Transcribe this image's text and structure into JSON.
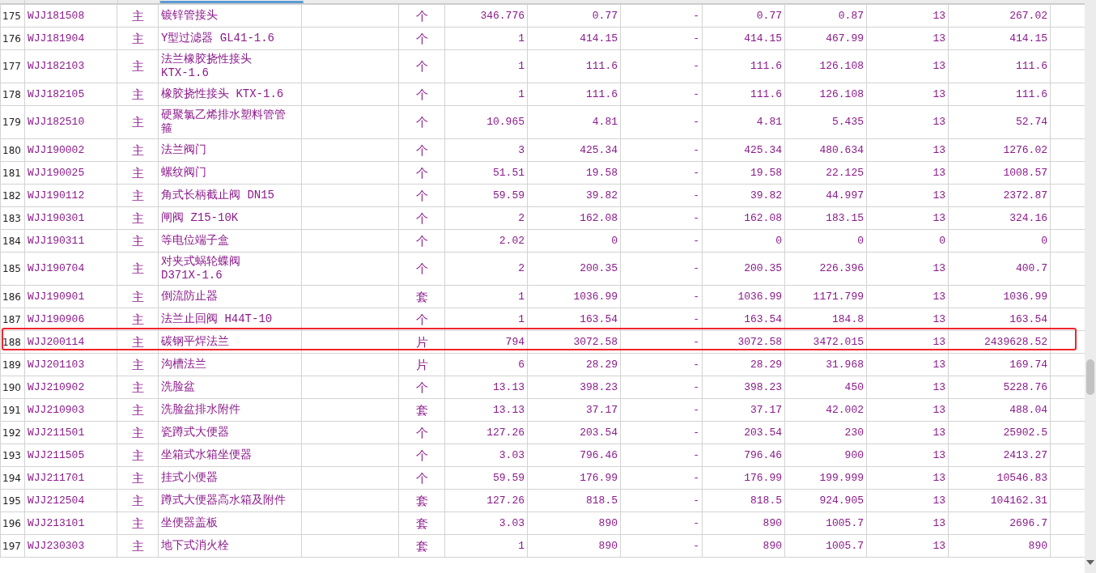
{
  "rows": [
    {
      "cells": [
        "175",
        "WJJ181508",
        "主",
        "镀锌管接头",
        "个",
        "346.776",
        "0.77",
        "-",
        "0.77",
        "0.87",
        "13",
        "267.02"
      ],
      "highlighted": false
    },
    {
      "cells": [
        "176",
        "WJJ181904",
        "主",
        "Y型过滤器 GL41-1.6",
        "个",
        "1",
        "414.15",
        "-",
        "414.15",
        "467.99",
        "13",
        "414.15"
      ],
      "highlighted": false
    },
    {
      "cells": [
        "177",
        "WJJ182103",
        "主",
        "法兰橡胶挠性接头 KTX-1.6",
        "个",
        "1",
        "111.6",
        "-",
        "111.6",
        "126.108",
        "13",
        "111.6"
      ],
      "highlighted": false
    },
    {
      "cells": [
        "178",
        "WJJ182105",
        "主",
        "橡胶挠性接头 KTX-1.6",
        "个",
        "1",
        "111.6",
        "-",
        "111.6",
        "126.108",
        "13",
        "111.6"
      ],
      "highlighted": false
    },
    {
      "cells": [
        "179",
        "WJJ182510",
        "主",
        "硬聚氯乙烯排水塑料管管箍",
        "个",
        "10.965",
        "4.81",
        "-",
        "4.81",
        "5.435",
        "13",
        "52.74"
      ],
      "highlighted": false
    },
    {
      "cells": [
        "180",
        "WJJ190002",
        "主",
        "法兰阀门",
        "个",
        "3",
        "425.34",
        "-",
        "425.34",
        "480.634",
        "13",
        "1276.02"
      ],
      "highlighted": false
    },
    {
      "cells": [
        "181",
        "WJJ190025",
        "主",
        "螺纹阀门",
        "个",
        "51.51",
        "19.58",
        "-",
        "19.58",
        "22.125",
        "13",
        "1008.57"
      ],
      "highlighted": false
    },
    {
      "cells": [
        "182",
        "WJJ190112",
        "主",
        "角式长柄截止阀 DN15",
        "个",
        "59.59",
        "39.82",
        "-",
        "39.82",
        "44.997",
        "13",
        "2372.87"
      ],
      "highlighted": false
    },
    {
      "cells": [
        "183",
        "WJJ190301",
        "主",
        "闸阀 Z15-10K",
        "个",
        "2",
        "162.08",
        "-",
        "162.08",
        "183.15",
        "13",
        "324.16"
      ],
      "highlighted": false
    },
    {
      "cells": [
        "184",
        "WJJ190311",
        "主",
        "等电位端子盒",
        "个",
        "2.02",
        "0",
        "-",
        "0",
        "0",
        "0",
        "0"
      ],
      "highlighted": false
    },
    {
      "cells": [
        "185",
        "WJJ190704",
        "主",
        "对夹式蜗轮蝶阀 D371X-1.6",
        "个",
        "2",
        "200.35",
        "-",
        "200.35",
        "226.396",
        "13",
        "400.7"
      ],
      "highlighted": false
    },
    {
      "cells": [
        "186",
        "WJJ190901",
        "主",
        "倒流防止器",
        "套",
        "1",
        "1036.99",
        "-",
        "1036.99",
        "1171.799",
        "13",
        "1036.99"
      ],
      "highlighted": false
    },
    {
      "cells": [
        "187",
        "WJJ190906",
        "主",
        "法兰止回阀 H44T-10",
        "个",
        "1",
        "163.54",
        "-",
        "163.54",
        "184.8",
        "13",
        "163.54"
      ],
      "highlighted": false
    },
    {
      "cells": [
        "188",
        "WJJ200114",
        "主",
        "碳钢平焊法兰",
        "片",
        "794",
        "3072.58",
        "-",
        "3072.58",
        "3472.015",
        "13",
        "2439628.52"
      ],
      "highlighted": true
    },
    {
      "cells": [
        "189",
        "WJJ201103",
        "主",
        "沟槽法兰",
        "片",
        "6",
        "28.29",
        "-",
        "28.29",
        "31.968",
        "13",
        "169.74"
      ],
      "highlighted": false
    },
    {
      "cells": [
        "190",
        "WJJ210902",
        "主",
        "洗脸盆",
        "个",
        "13.13",
        "398.23",
        "-",
        "398.23",
        "450",
        "13",
        "5228.76"
      ],
      "highlighted": false
    },
    {
      "cells": [
        "191",
        "WJJ210903",
        "主",
        "洗脸盆排水附件",
        "套",
        "13.13",
        "37.17",
        "-",
        "37.17",
        "42.002",
        "13",
        "488.04"
      ],
      "highlighted": false
    },
    {
      "cells": [
        "192",
        "WJJ211501",
        "主",
        "瓷蹲式大便器",
        "个",
        "127.26",
        "203.54",
        "-",
        "203.54",
        "230",
        "13",
        "25902.5"
      ],
      "highlighted": false
    },
    {
      "cells": [
        "193",
        "WJJ211505",
        "主",
        "坐箱式水箱坐便器",
        "个",
        "3.03",
        "796.46",
        "-",
        "796.46",
        "900",
        "13",
        "2413.27"
      ],
      "highlighted": false
    },
    {
      "cells": [
        "194",
        "WJJ211701",
        "主",
        "挂式小便器",
        "个",
        "59.59",
        "176.99",
        "-",
        "176.99",
        "199.999",
        "13",
        "10546.83"
      ],
      "highlighted": false
    },
    {
      "cells": [
        "195",
        "WJJ212504",
        "主",
        "蹲式大便器高水箱及附件",
        "套",
        "127.26",
        "818.5",
        "-",
        "818.5",
        "924.905",
        "13",
        "104162.31"
      ],
      "highlighted": false
    },
    {
      "cells": [
        "196",
        "WJJ213101",
        "主",
        "坐便器盖板",
        "套",
        "3.03",
        "890",
        "-",
        "890",
        "1005.7",
        "13",
        "2696.7"
      ],
      "highlighted": false
    },
    {
      "cells": [
        "197",
        "WJJ230303",
        "主",
        "地下式消火栓",
        "套",
        "1",
        "890",
        "-",
        "890",
        "1005.7",
        "13",
        "890"
      ],
      "highlighted": false
    }
  ]
}
